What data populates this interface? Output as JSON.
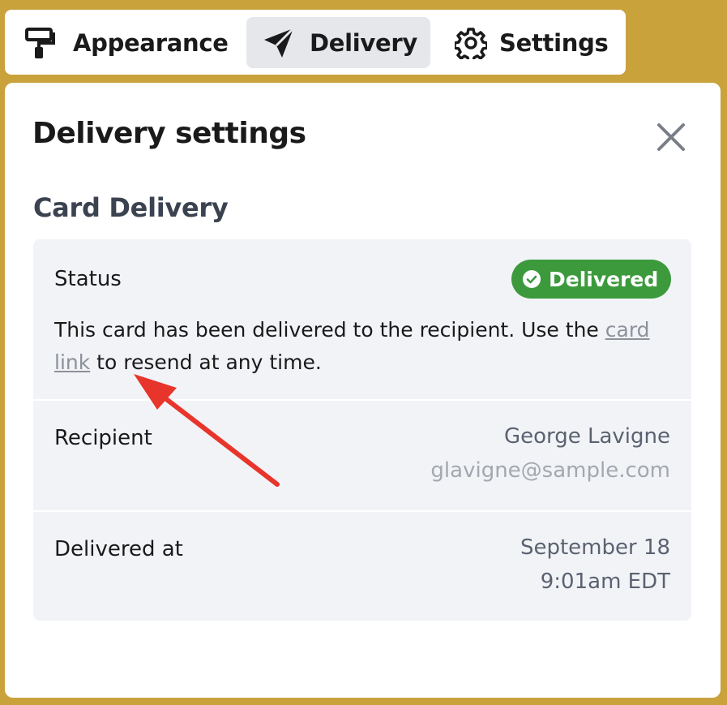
{
  "tabs": [
    {
      "label": "Appearance",
      "icon": "paint-roller-icon",
      "active": false
    },
    {
      "label": "Delivery",
      "icon": "send-icon",
      "active": true
    },
    {
      "label": "Settings",
      "icon": "gear-icon",
      "active": false
    }
  ],
  "panel": {
    "title": "Delivery settings",
    "section_title": "Card Delivery"
  },
  "status": {
    "label": "Status",
    "badge": "Delivered",
    "badge_color": "#3c9a3c",
    "desc_before": "This card has been delivered to the recipient. Use the ",
    "link_text": "card link",
    "desc_after": " to resend at any time."
  },
  "recipient": {
    "label": "Recipient",
    "name": "George Lavigne",
    "email": "glavigne@sample.com"
  },
  "delivered_at": {
    "label": "Delivered at",
    "date": "September 18",
    "time": "9:01am EDT"
  },
  "colors": {
    "background": "#c9a23c",
    "annotation_arrow": "#e8352b"
  }
}
